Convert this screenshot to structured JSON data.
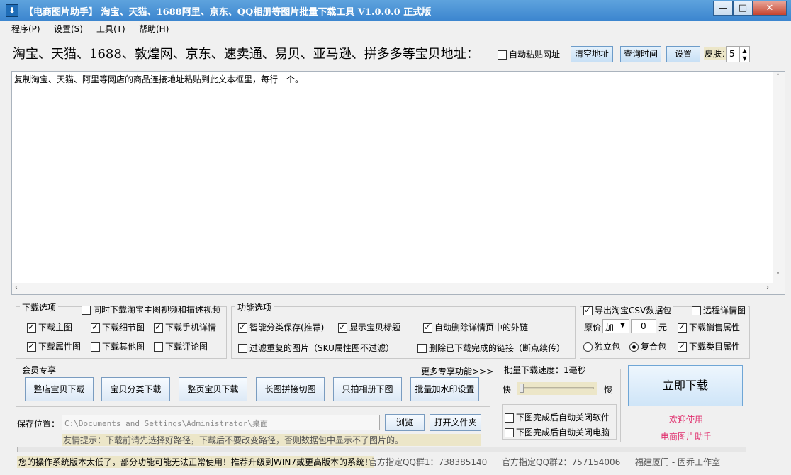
{
  "window": {
    "title": "【电商图片助手】 淘宝、天猫、1688阿里、京东、QQ相册等图片批量下载工具 V1.0.0.0 正式版",
    "minimize": "—",
    "maximize": "□",
    "close": "✕"
  },
  "menu": [
    "程序(P)",
    "设置(S)",
    "工具(T)",
    "帮助(H)"
  ],
  "address_row": {
    "label": "淘宝、天猫、1688、敦煌网、京东、速卖通、易贝、亚马逊、拼多多等宝贝地址：",
    "auto_paste": "自动粘贴网址",
    "clear_btn": "清空地址",
    "query_btn": "查询时间",
    "settings_btn": "设置",
    "skin_label": "皮肤：",
    "skin_value": "5"
  },
  "textarea": {
    "content": "复制淘宝、天猫、阿里等网店的商品连接地址粘贴到此文本框里，每行一个。"
  },
  "download_options": {
    "title": "下载选项",
    "sync_video": "同时下载淘宝主图视频和描述视频",
    "main_img": "下载主图",
    "detail_img": "下载细节图",
    "mobile_detail": "下载手机详情",
    "attr_img": "下载属性图",
    "other_img": "下载其他图",
    "comment_img": "下载评论图"
  },
  "function_options": {
    "title": "功能选项",
    "smart_save": "智能分类保存(推荐)",
    "show_title": "显示宝贝标题",
    "auto_delete_links": "自动删除详情页中的外链",
    "filter_dup": "过滤重复的图片（SKU属性图不过滤）",
    "delete_done": "删除已下载完成的链接（断点续传）"
  },
  "csv_options": {
    "export_csv": "导出淘宝CSV数据包",
    "remote_detail": "远程详情图",
    "price_label": "原价",
    "price_op": "加",
    "price_value": "0",
    "unit": "元",
    "sales_attr": "下载销售属性",
    "single_pack": "独立包",
    "combo_pack": "复合包",
    "category_attr": "下载类目属性"
  },
  "member": {
    "title": "会员专享",
    "more": "更多专享功能>>>",
    "buttons": [
      "整店宝贝下载",
      "宝贝分类下载",
      "整页宝贝下载",
      "长图拼接切图",
      "只拍相册下图",
      "批量加水印设置"
    ]
  },
  "speed": {
    "title": "批量下载速度：1毫秒",
    "fast": "快",
    "slow": "慢",
    "close_app": "下图完成后自动关闭软件",
    "close_pc": "下图完成后自动关闭电脑"
  },
  "save": {
    "label": "保存位置：",
    "path": "C:\\Documents and Settings\\Administrator\\桌面",
    "browse": "浏览",
    "open_folder": "打开文件夹",
    "tip": "友情提示：下载前请先选择好路径，下载后不要改变路径，否则数据包中显示不了图片的。"
  },
  "download_now": "立即下载",
  "welcome1": "欢迎使用",
  "welcome2": "电商图片助手",
  "status": {
    "warning": "您的操作系统版本太低了，部分功能可能无法正常使用！推荐升级到WIN7或更高版本的系统！",
    "qq1": "官方指定QQ群1：738385140",
    "qq2": "官方指定QQ群2：757154006",
    "studio": "福建厦门 - 固乔工作室"
  },
  "colors": {
    "title_bar": "#3c86cf",
    "accent_pink": "#e0306e"
  }
}
